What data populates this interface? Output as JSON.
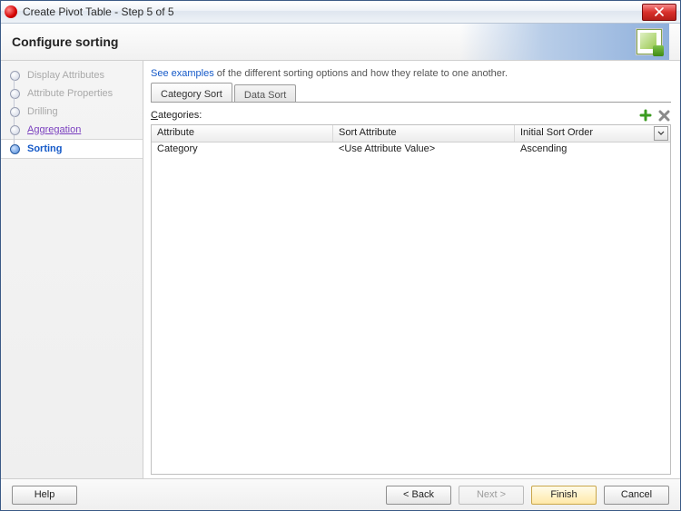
{
  "window": {
    "title": "Create Pivot Table - Step 5 of 5"
  },
  "header": {
    "title": "Configure sorting"
  },
  "hint": {
    "link_text": "See examples",
    "rest": " of the different sorting options and how they relate to one another."
  },
  "sidebar": {
    "steps": [
      {
        "label": "Display Attributes"
      },
      {
        "label": "Attribute Properties"
      },
      {
        "label": "Drilling"
      },
      {
        "label": "Aggregation"
      },
      {
        "label": "Sorting"
      }
    ]
  },
  "tabs": {
    "category_sort": "Category Sort",
    "data_sort": "Data Sort"
  },
  "categories": {
    "label_pre": "C",
    "label_rest": "ategories:"
  },
  "table": {
    "headers": {
      "attribute": "Attribute",
      "sort_attribute": "Sort Attribute",
      "initial_sort_order": "Initial Sort Order"
    },
    "rows": [
      {
        "attribute": "Category",
        "sort_attribute": "<Use Attribute Value>",
        "initial_sort_order": "Ascending"
      }
    ]
  },
  "footer": {
    "help": "Help",
    "back": "< Back",
    "next": "Next >",
    "finish": "Finish",
    "cancel": "Cancel"
  }
}
